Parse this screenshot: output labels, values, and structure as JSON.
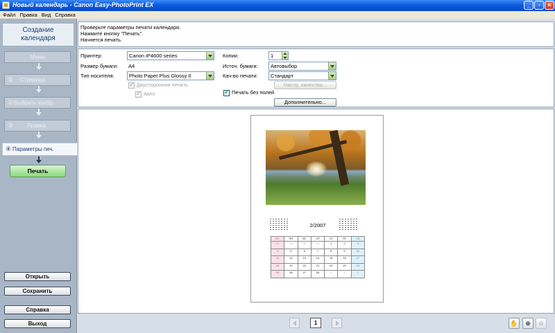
{
  "window": {
    "title": "Новый календарь - Canon Easy-PhotoPrint EX"
  },
  "menu": [
    "Файл",
    "Правка",
    "Вид",
    "Справка"
  ],
  "sidebar": {
    "title_line1": "Создание",
    "title_line2": "календаря",
    "steps": [
      {
        "num": "",
        "label": "Меню"
      },
      {
        "num": "①",
        "label": "Страница"
      },
      {
        "num": "②",
        "label": "Выбрать изобр."
      },
      {
        "num": "③",
        "label": "Правка"
      },
      {
        "num": "④",
        "label": "Параметры печ."
      }
    ],
    "print_button": "Печать",
    "open_button": "Открыть",
    "save_button": "Сохранить",
    "help_button": "Справка",
    "exit_button": "Выход"
  },
  "instructions": [
    "Проверьте параметры печати календаря.",
    "Нажмите кнопку \"Печать\".",
    "Начнется печать."
  ],
  "settings": {
    "printer_label": "Принтер:",
    "printer_value": "Canon iP4600 series",
    "paper_size_label": "Размер бумаги:",
    "paper_size_value": "A4",
    "media_type_label": "Тип носителя:",
    "media_type_value": "Photo Paper Plus Glossy II",
    "duplex_label": "Двусторонняя печать",
    "auto_label": "Авто",
    "copies_label": "Копии:",
    "copies_value": "1",
    "paper_source_label": "Источ. бумаги:",
    "paper_source_value": "Автовыбор",
    "quality_label": "Кач-во печати:",
    "quality_value": "Стандарт",
    "quality_settings_button": "Настр. качества...",
    "borderless_label": "Печать без полей",
    "advanced_button": "Дополнительно..."
  },
  "calendar": {
    "title": "2/2007",
    "weekdays": [
      "ВС",
      "ПН",
      "ВТ",
      "СР",
      "ЧТ",
      "ПТ",
      "СБ"
    ],
    "weeks": [
      [
        "28",
        "29",
        "30",
        "31",
        "1",
        "2",
        "3"
      ],
      [
        "4",
        "5",
        "6",
        "7",
        "8",
        "9",
        "10"
      ],
      [
        "11",
        "12",
        "13",
        "14",
        "15",
        "16",
        "17"
      ],
      [
        "18",
        "19",
        "20",
        "21",
        "22",
        "23",
        "24"
      ],
      [
        "25",
        "26",
        "27",
        "28",
        "1",
        "2",
        "3"
      ]
    ]
  },
  "pager": {
    "page": "1"
  },
  "icons": {
    "prev": "chevron-left-icon",
    "next": "chevron-right-icon",
    "hand": "hand-icon",
    "zoom_in": "zoom-in-icon",
    "zoom_out": "zoom-out-icon"
  }
}
